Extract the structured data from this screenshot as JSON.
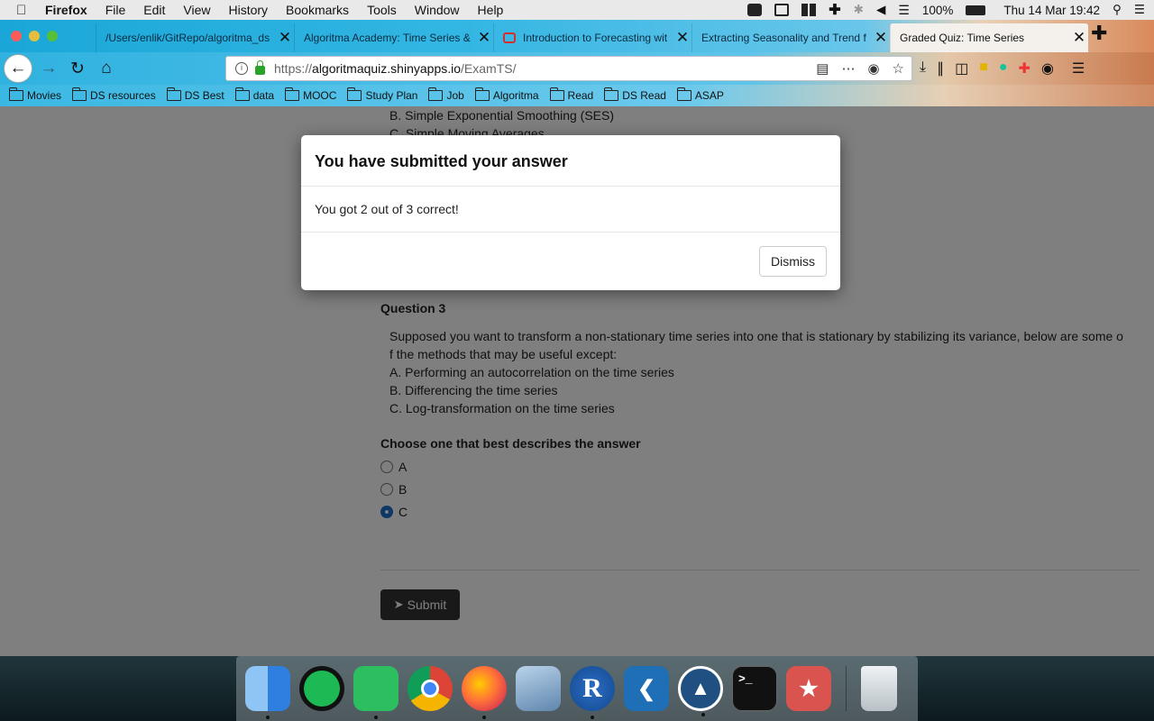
{
  "menubar": {
    "app": "Firefox",
    "items": [
      "File",
      "Edit",
      "View",
      "History",
      "Bookmarks",
      "Tools",
      "Window",
      "Help"
    ],
    "battery": "100%",
    "clock": "Thu 14 Mar  19:42"
  },
  "tabs": [
    {
      "title": "/Users/enlik/GitRepo/algoritma_ds"
    },
    {
      "title": "Algoritma Academy: Time Series &"
    },
    {
      "title": "Introduction to Forecasting wit"
    },
    {
      "title": "Extracting Seasonality and Trend f"
    },
    {
      "title": "Graded Quiz: Time Series"
    }
  ],
  "address": {
    "prefix": "https://",
    "host": "algoritmaquiz.shinyapps.io",
    "path": "/ExamTS/"
  },
  "bookmarks": [
    "Movies",
    "DS resources",
    "DS Best",
    "data",
    "MOOC",
    "Study Plan",
    "Job",
    "Algoritma",
    "Read",
    "DS Read",
    "ASAP"
  ],
  "quiz": {
    "prev_option_b": "B.  Simple Exponential Smoothing (SES)",
    "prev_option_c": "C.  Simple Moving Averages",
    "question_title": "Question 3",
    "question_line1": "Supposed you want to transform a non-stationary time series into one that is stationary by stabilizing its variance, below are some o",
    "question_line2": "f the methods that may be useful except:",
    "option_a": "A.  Performing an autocorrelation on the time series",
    "option_b": "B.  Differencing the time series",
    "option_c": "C.  Log-transformation on the time series",
    "choose_label": "Choose one that best describes the answer",
    "choices": [
      "A",
      "B",
      "C"
    ],
    "selected": "C",
    "submit_label": "Submit"
  },
  "modal": {
    "title": "You have submitted your answer",
    "body": "You got 2 out of 3 correct!",
    "dismiss_label": "Dismiss"
  },
  "dock": [
    {
      "icon": "finder-icon",
      "color": "#3d8ee8"
    },
    {
      "icon": "spotify-icon",
      "color": "#1db954"
    },
    {
      "icon": "evernote-icon",
      "color": "#2dbe60"
    },
    {
      "icon": "chrome-icon",
      "color": "#e8e8e8"
    },
    {
      "icon": "firefox-icon",
      "color": "#e66000"
    },
    {
      "icon": "preview-icon",
      "color": "#8aa8c8"
    },
    {
      "icon": "r-icon",
      "color": "#2165b6"
    },
    {
      "icon": "vscode-icon",
      "color": "#1e6fb5"
    },
    {
      "icon": "sourcetree-icon",
      "color": "#205081"
    },
    {
      "icon": "terminal-icon",
      "color": "#111111"
    },
    {
      "icon": "wunderlist-icon",
      "color": "#d9534f"
    },
    {
      "icon": "trash-icon",
      "color": "#cfd6da"
    }
  ]
}
